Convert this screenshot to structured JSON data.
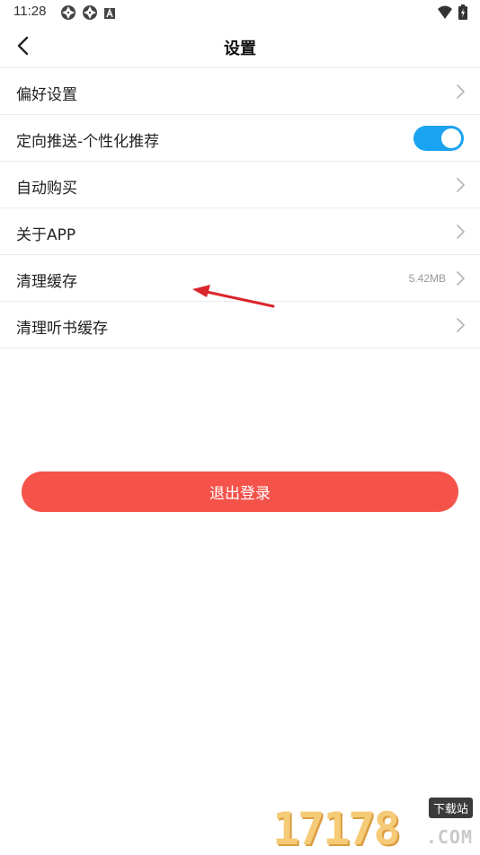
{
  "status_bar": {
    "time": "11:28",
    "left_icons": [
      "aperture-icon",
      "aperture-icon",
      "a-badge-icon"
    ],
    "right_icons": [
      "wifi-icon",
      "battery-charging-icon"
    ]
  },
  "nav": {
    "title": "设置",
    "back_icon": "chevron-left-icon"
  },
  "settings": {
    "items": [
      {
        "label": "偏好设置",
        "type": "link"
      },
      {
        "label": "定向推送-个性化推荐",
        "type": "toggle",
        "toggle_on": true
      },
      {
        "label": "自动购买",
        "type": "link"
      },
      {
        "label": "关于APP",
        "type": "link"
      },
      {
        "label": "清理缓存",
        "type": "link",
        "value": "5.42MB"
      },
      {
        "label": "清理听书缓存",
        "type": "link"
      }
    ]
  },
  "logout": {
    "label": "退出登录"
  },
  "watermark": {
    "digits": "17178",
    "badge": "下载站",
    "suffix": ".COM"
  },
  "colors": {
    "accent_blue": "#1aa3f0",
    "logout_red": "#f5524a",
    "annotation_red": "#d9262c"
  }
}
